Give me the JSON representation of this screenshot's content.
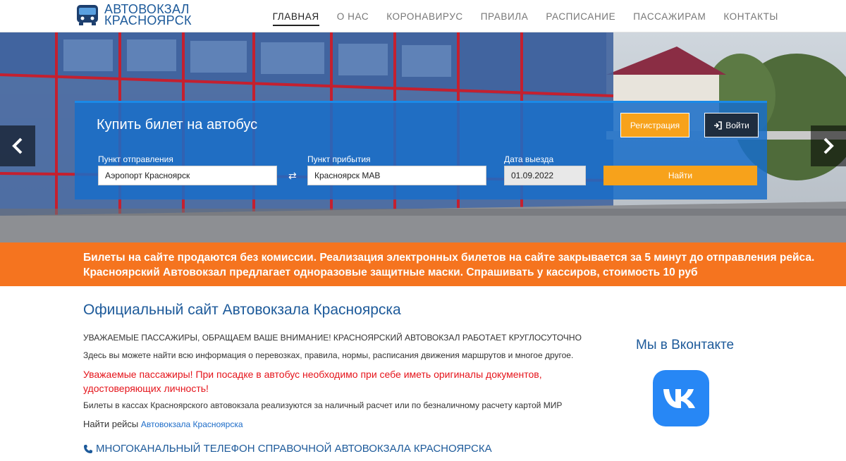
{
  "header": {
    "logo_line1": "АВТОВОКЗАЛ",
    "logo_line2": "КРАСНОЯРСК",
    "nav": [
      {
        "label": "ГЛАВНАЯ",
        "active": true
      },
      {
        "label": "О НАС",
        "active": false
      },
      {
        "label": "КОРОНАВИРУС",
        "active": false
      },
      {
        "label": "ПРАВИЛА",
        "active": false
      },
      {
        "label": "РАСПИСАНИЕ",
        "active": false
      },
      {
        "label": "ПАССАЖИРАМ",
        "active": false
      },
      {
        "label": "КОНТАКТЫ",
        "active": false
      }
    ]
  },
  "hero": {
    "prev_icon": "chevron-left-icon",
    "next_icon": "chevron-right-icon"
  },
  "booking": {
    "title": "Купить билет на автобус",
    "register_label": "Регистрация",
    "login_label": "Войти",
    "departure_label": "Пункт отправления",
    "departure_value": "Аэропорт Красноярск",
    "arrival_label": "Пункт прибытия",
    "arrival_value": "Красноярск МАВ",
    "date_label": "Дата выезда",
    "date_value": "01.09.2022",
    "swap_icon": "⇄",
    "find_label": "Найти"
  },
  "banner": {
    "line1": "Билеты на сайте продаются без комиссии. Реализация электронных билетов на сайте закрывается за 5 минут до отправления рейса.",
    "line2": "Красноярский Автовокзал предлагает одноразовые защитные маски. Спрашивать у кассиров, стоимость 10 руб"
  },
  "content": {
    "title": "Официальный сайт Автовокзала Красноярска",
    "notice": "УВАЖАЕМЫЕ ПАССАЖИРЫ, ОБРАЩАЕМ ВАШЕ ВНИМАНИЕ! КРАСНОЯРСКИЙ АВТОВОКЗАЛ РАБОТАЕТ КРУГЛОСУТОЧНО",
    "info": "Здесь вы можете найти всю информация о перевозках, правила, нормы, расписания движения маршрутов и многое другое.",
    "warning": "Уважаемые пассажиры! При посадке в автобус необходимо при себе иметь оригиналы документов, удостоверяющих личность!",
    "payment": "Билеты в кассах Красноярского автовокзала реализуются за наличный расчет или по безналичному расчету картой МИР",
    "find_prefix": "Найти рейсы",
    "find_link": "Автовокзала Красноярска",
    "phone_heading": "МНОГОКАНАЛЬНЫЙ ТЕЛЕФОН СПРАВОЧНОЙ АВТОВОКЗАЛА КРАСНОЯРСКА"
  },
  "sidebar": {
    "vk_title": "Мы в Вконтакте",
    "vk_icon": "vk-icon"
  },
  "colors": {
    "brand_blue": "#1d5a9a",
    "accent_orange": "#f7a21b",
    "banner_orange": "#f5741f",
    "warning_red": "#e5141b",
    "vk_blue": "#2787f5"
  }
}
